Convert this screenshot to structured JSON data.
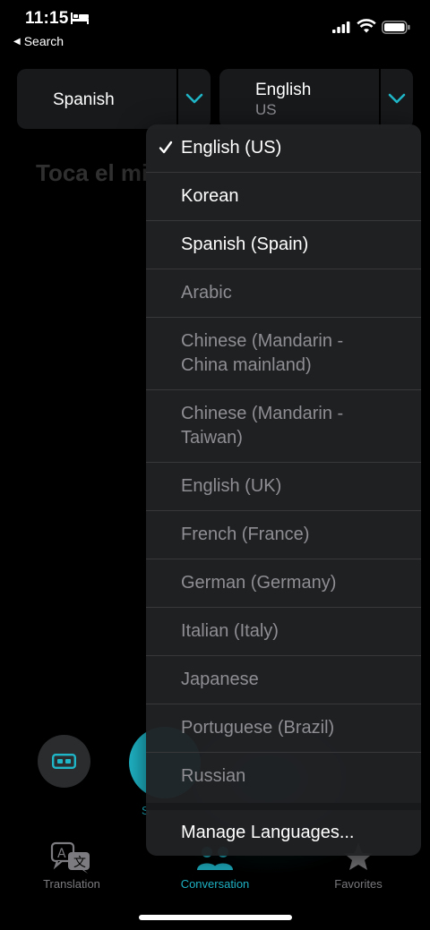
{
  "status_bar": {
    "time": "11:15",
    "back_label": "Search"
  },
  "source_language": {
    "label": "Spanish"
  },
  "target_language": {
    "label": "English",
    "sublabel": "US"
  },
  "prompt": "Toca el mi",
  "mic_label": "S",
  "dropdown": {
    "items": [
      {
        "label": "English (US)",
        "selected": true,
        "enabled": true
      },
      {
        "label": "Korean",
        "enabled": true
      },
      {
        "label": "Spanish (Spain)",
        "enabled": true
      },
      {
        "label": "Arabic",
        "enabled": false
      },
      {
        "label": "Chinese (Mandarin - China mainland)",
        "enabled": false
      },
      {
        "label": "Chinese (Mandarin - Taiwan)",
        "enabled": false
      },
      {
        "label": "English (UK)",
        "enabled": false
      },
      {
        "label": "French (France)",
        "enabled": false
      },
      {
        "label": "German (Germany)",
        "enabled": false
      },
      {
        "label": "Italian (Italy)",
        "enabled": false
      },
      {
        "label": "Japanese",
        "enabled": false
      },
      {
        "label": "Portuguese (Brazil)",
        "enabled": false
      },
      {
        "label": "Russian",
        "enabled": false
      }
    ],
    "manage_label": "Manage Languages..."
  },
  "tabs": {
    "translation": "Translation",
    "conversation": "Conversation",
    "favorites": "Favorites",
    "active": "conversation"
  },
  "colors": {
    "accent": "#1fb6c8",
    "background": "#000000",
    "menu_bg": "#202123",
    "disabled_text": "#8e8e93"
  }
}
